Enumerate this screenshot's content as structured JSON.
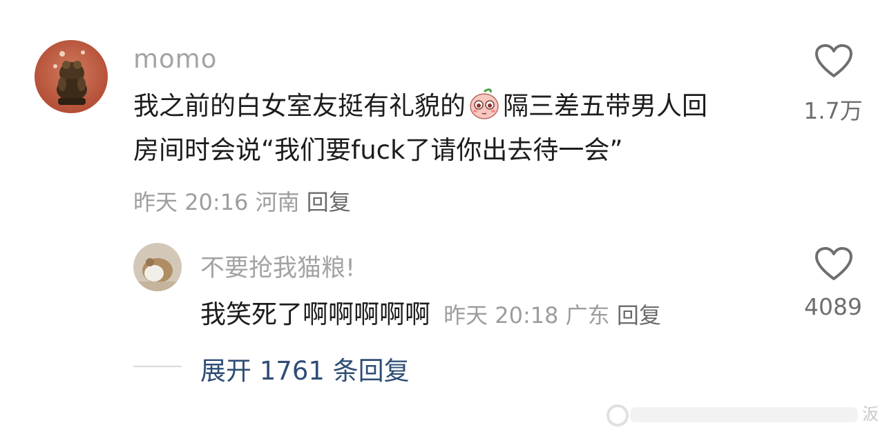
{
  "comment": {
    "username": "momo",
    "text_line1_part1": "我之前的白女室友挺有礼貌的",
    "emoji_name": "peach-face-emoji",
    "text_line1_part2": "隔三差五带男人回",
    "text_line2": "房间时会说“我们要fuck了请你出去待一会”",
    "date": "昨天",
    "time": "20:16",
    "location": "河南",
    "reply_label": "回复",
    "likes": "1.7万"
  },
  "reply": {
    "username": "不要抢我猫粮!",
    "text": "我笑死了啊啊啊啊啊",
    "date": "昨天",
    "time": "20:18",
    "location": "广东",
    "reply_label": "回复",
    "likes": "4089"
  },
  "expand": {
    "label": "展开 1761 条回复"
  },
  "watermark": {
    "partial_char": "汳"
  },
  "colors": {
    "username_gray": "#a3a3a3",
    "meta_gray": "#9d9d9d",
    "link_blue": "#2f4d75"
  }
}
